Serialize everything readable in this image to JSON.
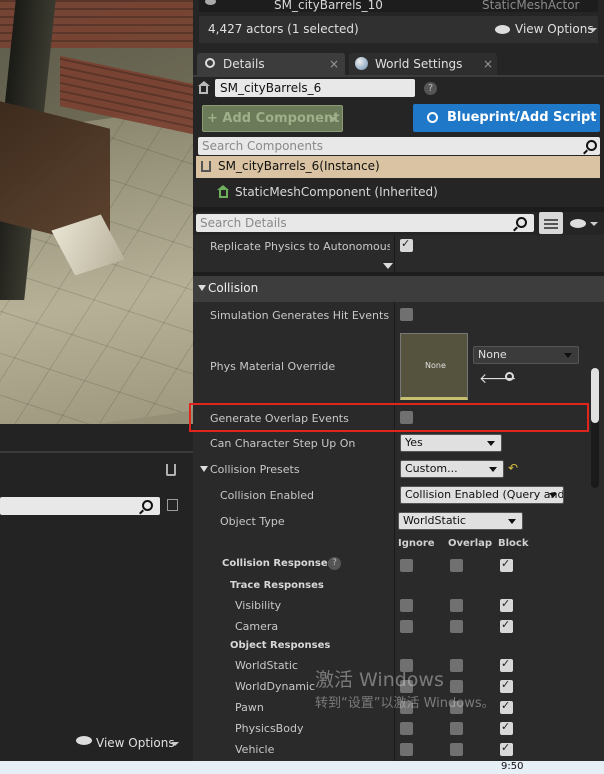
{
  "outliner": {
    "partial_item_name": "SM_cityBarrels_10",
    "partial_item_type": "StaticMeshActor",
    "actor_count": "4,427 actors (1 selected)",
    "view_options": "View Options"
  },
  "tabs": [
    {
      "label": "Details"
    },
    {
      "label": "World Settings"
    }
  ],
  "details": {
    "actor_name": "SM_cityBarrels_6",
    "add_component_label": "+ Add Component",
    "blueprint_label": "Blueprint/Add Script",
    "search_components_placeholder": "Search Components",
    "instance_label": "SM_cityBarrels_6(Instance)",
    "component_label": "StaticMeshComponent (Inherited)",
    "search_details_placeholder": "Search Details",
    "replicate_physics_label": "Replicate Physics to Autonomous Pr",
    "collision_section": "Collision",
    "sim_hit_events_label": "Simulation Generates Hit Events",
    "phys_material_label": "Phys Material Override",
    "phys_material_thumb": "None",
    "phys_material_value": "None",
    "generate_overlap_label": "Generate Overlap Events",
    "can_step_up_label": "Can Character Step Up On",
    "can_step_up_value": "Yes",
    "collision_presets_label": "Collision Presets",
    "collision_presets_value": "Custom...",
    "collision_enabled_label": "Collision Enabled",
    "collision_enabled_value": "Collision Enabled (Query and",
    "object_type_label": "Object Type",
    "object_type_value": "WorldStatic",
    "col_ignore": "Ignore",
    "col_overlap": "Overlap",
    "col_block": "Block",
    "collision_responses_label": "Collision Responses",
    "trace_responses_label": "Trace Responses",
    "object_responses_label": "Object Responses",
    "responses": [
      {
        "name": "Visibility"
      },
      {
        "name": "Camera"
      },
      {
        "name": "WorldStatic"
      },
      {
        "name": "WorldDynamic"
      },
      {
        "name": "Pawn"
      },
      {
        "name": "PhysicsBody"
      },
      {
        "name": "Vehicle"
      }
    ]
  },
  "left_panel": {
    "view_options": "View Options"
  },
  "watermark": {
    "line1": "激活 Windows",
    "line2": "转到“设置”以激活 Windows。"
  },
  "taskbar": {
    "time": "9:50"
  },
  "colors": {
    "highlight_box": "#e0261c",
    "blueprint_button": "#1f78c8",
    "instance_row": "#d9c3a2",
    "add_component_button": "#6b8c4a"
  }
}
